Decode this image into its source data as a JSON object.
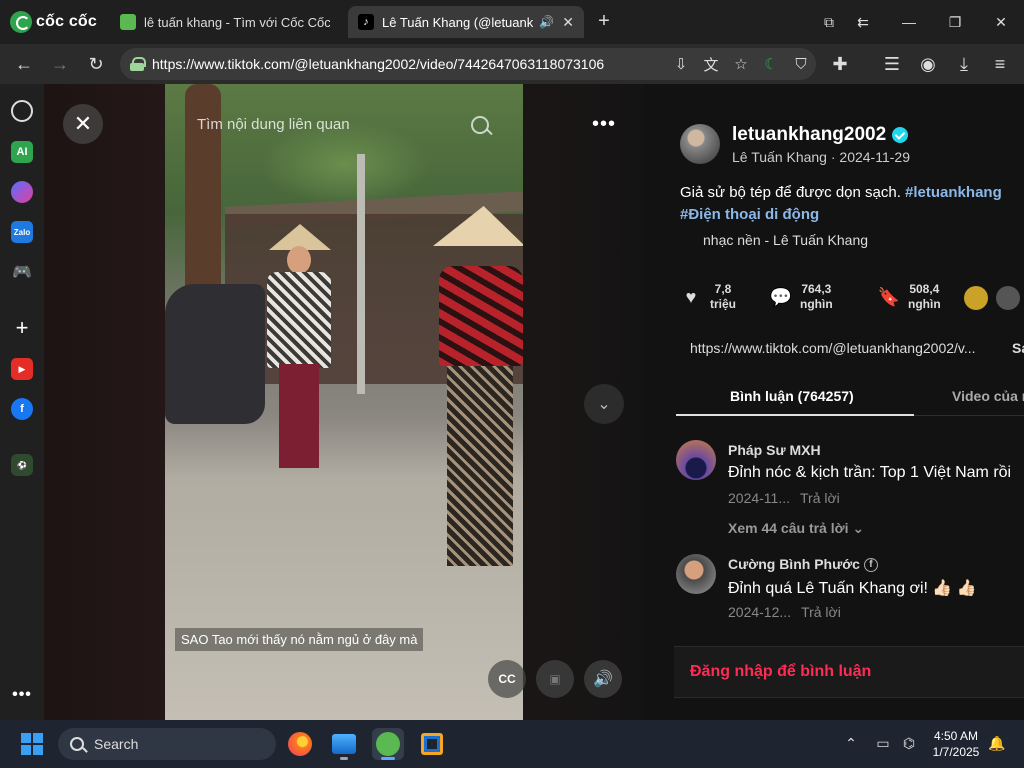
{
  "browser": {
    "brand": "cốc cốc",
    "tabs": [
      {
        "title": "lê tuấn khang - Tìm với Cốc Cốc",
        "active": false
      },
      {
        "title": "Lê Tuấn Khang (@letuank",
        "active": true
      }
    ],
    "url": "https://www.tiktok.com/@letuankhang2002/video/7442647063118073106"
  },
  "video": {
    "search_text": "Tìm nội dung liên quan",
    "subtitle": "SAO Tao mới thấy nó nằm ngủ ở đây mà",
    "cc_label": "CC"
  },
  "panel": {
    "username": "letuankhang2002",
    "author_line": "Lê Tuấn Khang · 2024-11-29",
    "caption": "Giả sử bộ tép để được dọn sạch. ",
    "hashtags": [
      "#letuankhang",
      "#Điện thoại di động"
    ],
    "music": "nhạc nền - Lê Tuấn Khang",
    "stats": {
      "likes": [
        "7,8",
        "triệu"
      ],
      "comments": [
        "764,3",
        "nghìn"
      ],
      "saves": [
        "508,4",
        "nghìn"
      ]
    },
    "link": "https://www.tiktok.com/@letuankhang2002/v...",
    "link_copy": "Sa",
    "tabs": {
      "comments": "Bình luận (764257)",
      "videos": "Video của n"
    },
    "comments": [
      {
        "name": "Pháp Sư MXH",
        "text": "Đỉnh nóc & kịch trần: Top 1 Việt Nam rồi",
        "date": "2024-11...",
        "reply": "Trả lời",
        "more": "Xem 44 câu trả lời"
      },
      {
        "name": "Cường Bình Phước",
        "text": "Đỉnh quá Lê Tuấn Khang ơi! 👍🏻 👍🏻",
        "date": "2024-12...",
        "reply": "Trả lời"
      }
    ],
    "login_cta": "Đăng nhập để bình luận"
  },
  "taskbar": {
    "search": "Search",
    "time": "4:50 AM",
    "date": "1/7/2025"
  },
  "colors": {
    "accent_red": "#fe2c55",
    "hashtag_blue": "#8bb8e8",
    "verified": "#20d5ec"
  }
}
